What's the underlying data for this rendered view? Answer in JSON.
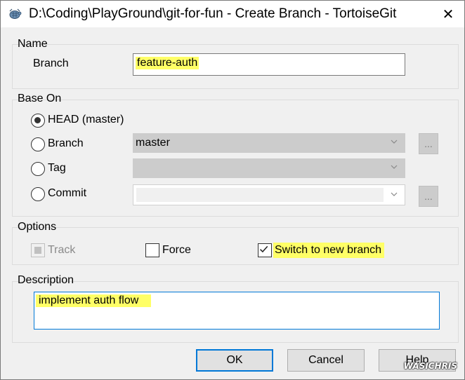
{
  "window": {
    "title": "D:\\Coding\\PlayGround\\git-for-fun - Create Branch - TortoiseGit",
    "close_glyph": "✕"
  },
  "name_group": {
    "label": "Name",
    "branch_label": "Branch",
    "branch_value": "feature-auth"
  },
  "base_on": {
    "label": "Base On",
    "options": [
      {
        "label": "HEAD (master)",
        "selected": true
      },
      {
        "label": "Branch",
        "selected": false
      },
      {
        "label": "Tag",
        "selected": false
      },
      {
        "label": "Commit",
        "selected": false
      }
    ],
    "branch_combo_value": "master",
    "tag_combo_value": "",
    "commit_combo_value": "",
    "browse_label": "..."
  },
  "options": {
    "label": "Options",
    "track": {
      "label": "Track",
      "checked": false,
      "disabled": true
    },
    "force": {
      "label": "Force",
      "checked": false
    },
    "switch": {
      "label": "Switch to new branch",
      "checked": true
    }
  },
  "description": {
    "label": "Description",
    "value": "implement auth flow"
  },
  "buttons": {
    "ok": "OK",
    "cancel": "Cancel",
    "help": "Help"
  },
  "watermark": "WASICHRIS",
  "colors": {
    "highlight": "#ffff66",
    "default_button_border": "#0078d7"
  }
}
